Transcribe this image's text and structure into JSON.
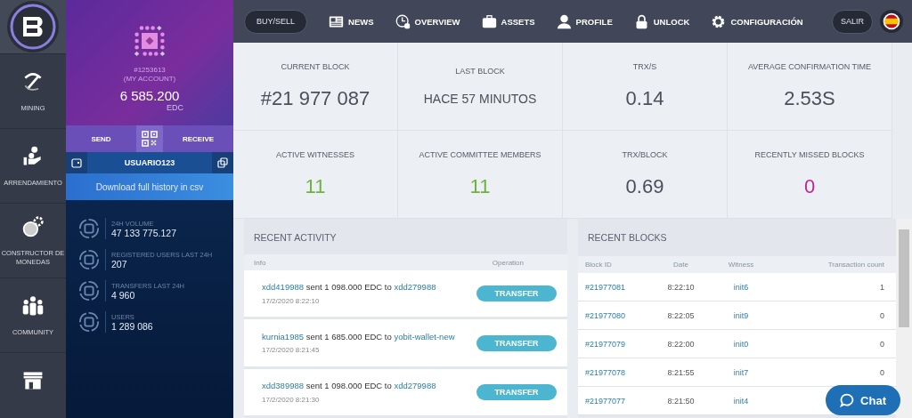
{
  "nav": [
    {
      "label": "MINING"
    },
    {
      "label": "ARRENDAMIENTO"
    },
    {
      "label": "CONSTRUCTOR DE MONEDAS"
    },
    {
      "label": "COMMUNITY"
    }
  ],
  "account": {
    "id": "#1253613",
    "caption": "(MY ACCOUNT)",
    "balance": "6 585.200",
    "currency": "EDC",
    "send": "SEND",
    "receive": "RECEIVE",
    "username": "USUARIO123",
    "download": "Download full history in csv",
    "stats": [
      {
        "label": "24H VOLUME",
        "value": "47 133 775.127"
      },
      {
        "label": "REGISTERED USERS LAST 24H",
        "value": "207"
      },
      {
        "label": "TRANSFERS LAST 24H",
        "value": "4 960"
      },
      {
        "label": "USERS",
        "value": "1 289 086"
      }
    ]
  },
  "topbar": {
    "buy_sell": "BUY/SELL",
    "links": [
      "NEWS",
      "OVERVIEW",
      "ASSETS",
      "PROFILE",
      "UNLOCK",
      "CONFIGURACIÓN"
    ],
    "logout": "SALIR"
  },
  "stats": [
    {
      "label": "CURRENT BLOCK",
      "value": "#21 977 087",
      "color": "#4a4f5c",
      "kind": "number"
    },
    {
      "label": "LAST BLOCK",
      "value": "HACE 57 MINUTOS",
      "color": "#4a4f5c",
      "kind": "text"
    },
    {
      "label": "TRX/S",
      "value": "0.14",
      "color": "#4a4f5c",
      "kind": "number"
    },
    {
      "label": "AVERAGE CONFIRMATION TIME",
      "value": "2.53S",
      "color": "#4a4f5c",
      "kind": "number"
    },
    {
      "label": "ACTIVE WITNESSES",
      "value": "11",
      "color": "#6cb33f",
      "kind": "number"
    },
    {
      "label": "ACTIVE COMMITTEE MEMBERS",
      "value": "11",
      "color": "#6cb33f",
      "kind": "number"
    },
    {
      "label": "TRX/BLOCK",
      "value": "0.69",
      "color": "#4a4f5c",
      "kind": "number"
    },
    {
      "label": "RECENTLY MISSED BLOCKS",
      "value": "0",
      "color": "#c4248f",
      "kind": "number"
    }
  ],
  "activity": {
    "title": "RECENT ACTIVITY",
    "columns": [
      "Info",
      "Operation"
    ],
    "rows": [
      {
        "from": "xdd419988",
        "text": "sent 1 098.000 EDC to",
        "to": "xdd279988",
        "date": "17/2/2020 8:22:10",
        "operation": "TRANSFER"
      },
      {
        "from": "kurnia1985",
        "text": "sent 1 685.000 EDC to",
        "to": "yobit-wallet-new",
        "date": "17/2/2020 8:21:45",
        "operation": "TRANSFER"
      },
      {
        "from": "xdd389988",
        "text": "sent 1 098.000 EDC to",
        "to": "xdd279988",
        "date": "17/2/2020 8:21:30",
        "operation": "TRANSFER"
      }
    ]
  },
  "blocks": {
    "title": "RECENT BLOCKS",
    "columns": [
      "Block ID",
      "Date",
      "Witness",
      "Transaction count"
    ],
    "rows": [
      [
        "#21977081",
        "8:22:10",
        "init6",
        "1"
      ],
      [
        "#21977080",
        "8:22:05",
        "init9",
        "0"
      ],
      [
        "#21977079",
        "8:22:00",
        "init0",
        "0"
      ],
      [
        "#21977078",
        "8:21:55",
        "init7",
        "0"
      ],
      [
        "#21977077",
        "8:21:50",
        "init4"
      ]
    ]
  },
  "chat": "Chat"
}
